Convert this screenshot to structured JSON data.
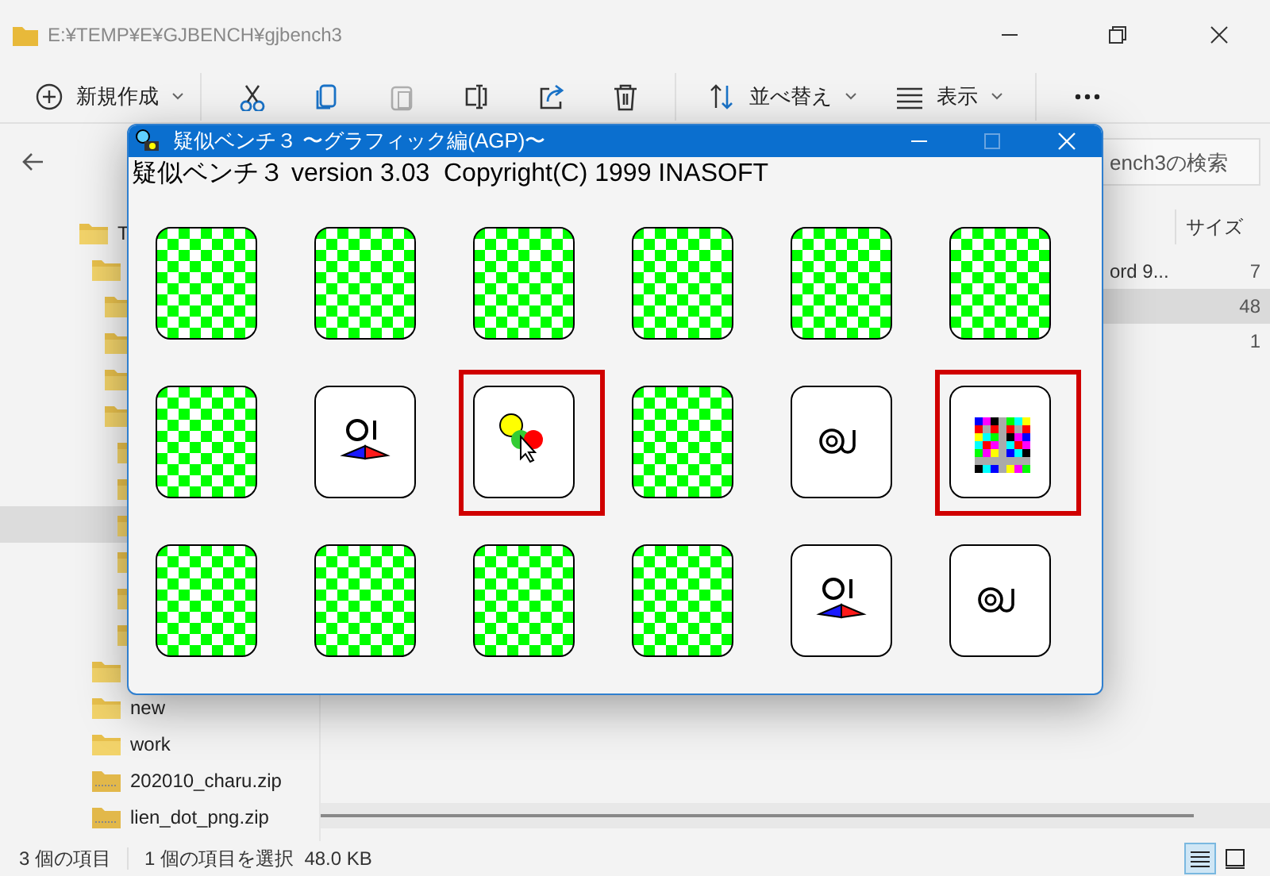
{
  "explorer": {
    "path": "E:¥TEMP¥E¥GJBENCH¥gjbench3",
    "toolbar": [
      {
        "kind": "new",
        "label": "新規作成"
      },
      {
        "kind": "cut"
      },
      {
        "kind": "copy"
      },
      {
        "kind": "paste",
        "disabled": true
      },
      {
        "kind": "rename"
      },
      {
        "kind": "share"
      },
      {
        "kind": "delete"
      },
      {
        "kind": "sort",
        "label": "並べ替え"
      },
      {
        "kind": "view",
        "label": "表示"
      },
      {
        "kind": "more"
      }
    ],
    "search": {
      "placeholder": "ench3の検索"
    },
    "tree": [
      {
        "label": "T",
        "kind": "folder",
        "selected": false,
        "children": [
          {
            "kind": "folder",
            "selected": false,
            "children": [
              {
                "kind": "folder",
                "selected": false
              },
              {
                "kind": "folder",
                "selected": false
              },
              {
                "kind": "folder",
                "selected": false
              },
              {
                "kind": "folder",
                "selected": false,
                "children": [
                  {
                    "kind": "folder",
                    "selected": false
                  },
                  {
                    "kind": "folder",
                    "selected": false
                  },
                  {
                    "kind": "folder",
                    "selected": true
                  },
                  {
                    "kind": "folder",
                    "selected": false
                  },
                  {
                    "kind": "folder",
                    "selected": false
                  },
                  {
                    "kind": "folder",
                    "selected": false
                  }
                ]
              }
            ]
          },
          {
            "kind": "folder",
            "selected": false
          },
          {
            "label": "new",
            "kind": "folder",
            "selected": false
          },
          {
            "label": "work",
            "kind": "folder",
            "selected": false
          },
          {
            "label": "202010_charu.zip",
            "kind": "zip",
            "selected": false
          },
          {
            "label": "lien_dot_png.zip",
            "kind": "zip",
            "selected": false
          }
        ]
      }
    ],
    "columns": [
      "サイズ"
    ],
    "rows": [
      {
        "name": "ord 9...",
        "size": "7",
        "selected": false
      },
      {
        "size": "48",
        "selected": true
      },
      {
        "size": "1",
        "selected": false
      }
    ],
    "status": [
      "3 個の項目",
      "1 個の項目を選択  48.0 KB"
    ],
    "views": [
      {
        "kind": "details",
        "selected": true
      },
      {
        "kind": "tiles",
        "selected": false
      }
    ]
  },
  "game": {
    "title": "疑似ベンチ３ 〜グラフィック編(AGP)〜",
    "header": "疑似ベンチ３ version 3.03  Copyright(C) 1999 INASOFT",
    "cards": [
      {
        "kind": "hidden",
        "marked": false
      },
      {
        "kind": "hidden",
        "marked": false
      },
      {
        "kind": "hidden",
        "marked": false
      },
      {
        "kind": "hidden",
        "marked": false
      },
      {
        "kind": "hidden",
        "marked": false
      },
      {
        "kind": "hidden",
        "marked": false
      },
      {
        "kind": "hidden",
        "marked": false
      },
      {
        "kind": "bowtie",
        "marked": false
      },
      {
        "kind": "balloon",
        "marked": true
      },
      {
        "kind": "hidden",
        "marked": false
      },
      {
        "kind": "rings",
        "marked": false
      },
      {
        "kind": "mosaic",
        "marked": true
      },
      {
        "kind": "hidden",
        "marked": false
      },
      {
        "kind": "hidden",
        "marked": false
      },
      {
        "kind": "hidden",
        "marked": false
      },
      {
        "kind": "hidden",
        "marked": false
      },
      {
        "kind": "bowtie",
        "marked": false
      },
      {
        "kind": "rings",
        "marked": false
      }
    ]
  }
}
